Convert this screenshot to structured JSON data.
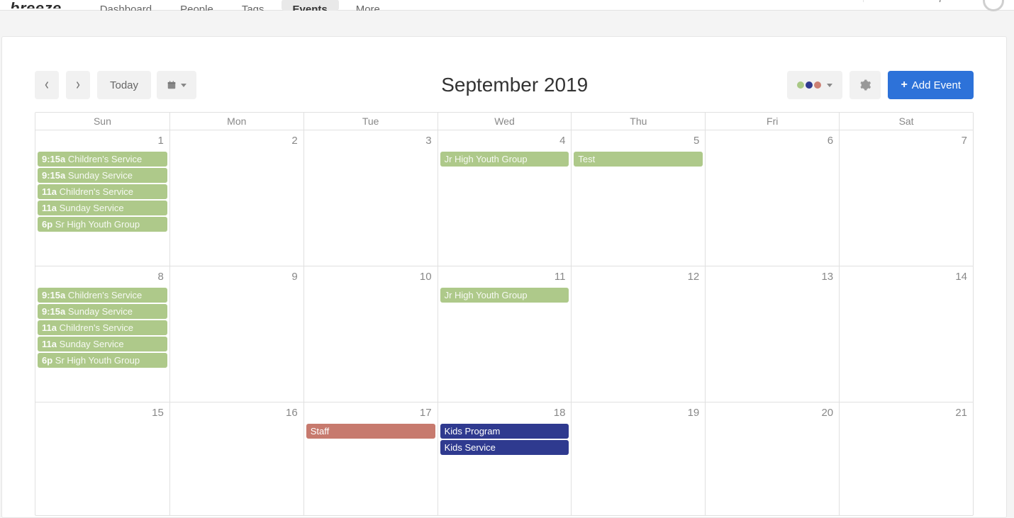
{
  "brand": "breeze",
  "nav": {
    "items": [
      {
        "label": "Dashboard"
      },
      {
        "label": "People"
      },
      {
        "label": "Tags"
      },
      {
        "label": "Events"
      },
      {
        "label": "More"
      }
    ],
    "active_index": 3,
    "search_placeholder": "Search People..."
  },
  "toolbar": {
    "today_label": "Today",
    "title": "September 2019",
    "add_event_label": "Add Event"
  },
  "days_of_week": [
    "Sun",
    "Mon",
    "Tue",
    "Wed",
    "Thu",
    "Fri",
    "Sat"
  ],
  "weeks": [
    {
      "days": [
        {
          "num": "1",
          "events": [
            {
              "time": "9:15a",
              "name": "Children's Service",
              "color": "green"
            },
            {
              "time": "9:15a",
              "name": "Sunday Service",
              "color": "green"
            },
            {
              "time": "11a",
              "name": "Children's Service",
              "color": "green"
            },
            {
              "time": "11a",
              "name": "Sunday Service",
              "color": "green"
            },
            {
              "time": "6p",
              "name": "Sr High Youth Group",
              "color": "green"
            }
          ]
        },
        {
          "num": "2",
          "events": []
        },
        {
          "num": "3",
          "events": []
        },
        {
          "num": "4",
          "events": [
            {
              "time": "",
              "name": "Jr High Youth Group",
              "color": "green"
            }
          ]
        },
        {
          "num": "5",
          "events": [
            {
              "time": "",
              "name": "Test",
              "color": "green"
            }
          ]
        },
        {
          "num": "6",
          "events": []
        },
        {
          "num": "7",
          "events": []
        }
      ]
    },
    {
      "days": [
        {
          "num": "8",
          "events": [
            {
              "time": "9:15a",
              "name": "Children's Service",
              "color": "green"
            },
            {
              "time": "9:15a",
              "name": "Sunday Service",
              "color": "green"
            },
            {
              "time": "11a",
              "name": "Children's Service",
              "color": "green"
            },
            {
              "time": "11a",
              "name": "Sunday Service",
              "color": "green"
            },
            {
              "time": "6p",
              "name": "Sr High Youth Group",
              "color": "green"
            }
          ]
        },
        {
          "num": "9",
          "events": []
        },
        {
          "num": "10",
          "events": []
        },
        {
          "num": "11",
          "events": [
            {
              "time": "",
              "name": "Jr High Youth Group",
              "color": "green"
            }
          ]
        },
        {
          "num": "12",
          "events": []
        },
        {
          "num": "13",
          "events": []
        },
        {
          "num": "14",
          "events": []
        }
      ]
    },
    {
      "days": [
        {
          "num": "15",
          "events": []
        },
        {
          "num": "16",
          "events": []
        },
        {
          "num": "17",
          "events": [
            {
              "time": "",
              "name": "Staff",
              "color": "red"
            }
          ]
        },
        {
          "num": "18",
          "events": [
            {
              "time": "",
              "name": "Kids Program",
              "color": "navy"
            },
            {
              "time": "",
              "name": "Kids Service",
              "color": "navy"
            }
          ]
        },
        {
          "num": "19",
          "events": []
        },
        {
          "num": "20",
          "events": []
        },
        {
          "num": "21",
          "events": []
        }
      ]
    }
  ]
}
